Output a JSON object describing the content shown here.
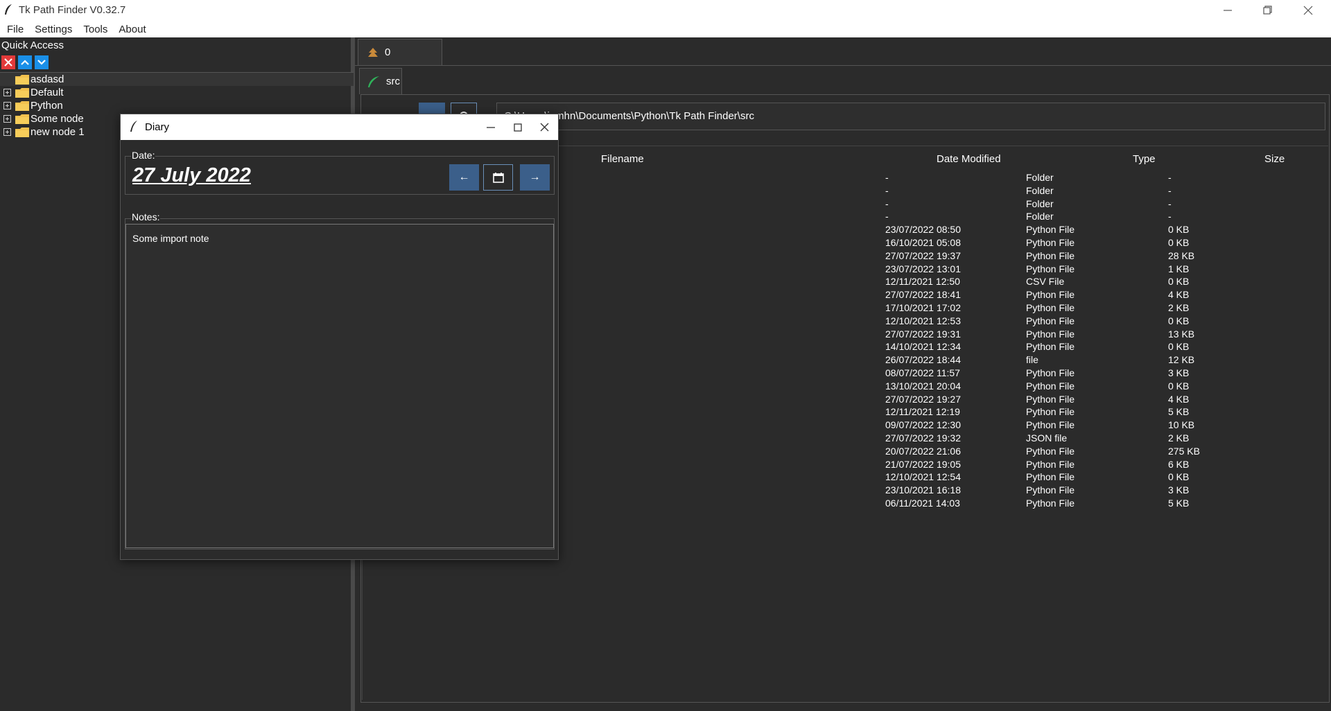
{
  "app": {
    "title": "Tk Path Finder V0.32.7"
  },
  "menu": [
    "File",
    "Settings",
    "Tools",
    "About"
  ],
  "quick_access": {
    "title": "Quick Access",
    "tree": [
      {
        "label": "asdasd",
        "expandable": false
      },
      {
        "label": "Default",
        "expandable": true
      },
      {
        "label": "Python",
        "expandable": true
      },
      {
        "label": "Some node",
        "expandable": true
      },
      {
        "label": "new node 1",
        "expandable": true
      }
    ]
  },
  "tabs": {
    "outer": {
      "label": "0",
      "icon": "tree-icon"
    },
    "inner": {
      "label": "src",
      "icon": "leaf-icon"
    }
  },
  "path": {
    "value": "C:\\Users\\jamhn\\Documents\\Python\\Tk Path Finder\\src"
  },
  "table": {
    "headers": [
      "Filename",
      "Date Modified",
      "Type",
      "Size"
    ],
    "rows": [
      {
        "date": "-",
        "type": "Folder",
        "size": "-"
      },
      {
        "date": "-",
        "type": "Folder",
        "size": "-"
      },
      {
        "date": "-",
        "type": "Folder",
        "size": "-"
      },
      {
        "date": "-",
        "type": "Folder",
        "size": "-"
      },
      {
        "date": "23/07/2022  08:50",
        "type": "Python File",
        "size": "0 KB"
      },
      {
        "date": "16/10/2021  05:08",
        "type": "Python File",
        "size": "0 KB"
      },
      {
        "date": "27/07/2022  19:37",
        "type": "Python File",
        "size": "28 KB"
      },
      {
        "date": "23/07/2022  13:01",
        "type": "Python File",
        "size": "1 KB"
      },
      {
        "date": "12/11/2021  12:50",
        "type": "CSV File",
        "size": "0 KB"
      },
      {
        "date": "27/07/2022  18:41",
        "type": "Python File",
        "size": "4 KB"
      },
      {
        "date": "17/10/2021  17:02",
        "type": "Python File",
        "size": "2 KB"
      },
      {
        "date": "12/10/2021  12:53",
        "type": "Python File",
        "size": "0 KB"
      },
      {
        "date": "27/07/2022  19:31",
        "type": "Python File",
        "size": "13 KB"
      },
      {
        "date": "14/10/2021  12:34",
        "type": "Python File",
        "size": "0 KB"
      },
      {
        "date": "26/07/2022  18:44",
        "type": "file",
        "size": "12 KB"
      },
      {
        "date": "08/07/2022  11:57",
        "type": "Python File",
        "size": "3 KB"
      },
      {
        "date": "13/10/2021  20:04",
        "type": "Python File",
        "size": "0 KB"
      },
      {
        "date": "27/07/2022  19:27",
        "type": "Python File",
        "size": "4 KB"
      },
      {
        "date": "12/11/2021  12:19",
        "type": "Python File",
        "size": "5 KB"
      },
      {
        "date": "09/07/2022  12:30",
        "type": "Python File",
        "size": "10 KB"
      },
      {
        "date": "27/07/2022  19:32",
        "type": "JSON file",
        "size": "2 KB"
      },
      {
        "date": "20/07/2022  21:06",
        "type": "Python File",
        "size": "275 KB"
      },
      {
        "date": "21/07/2022  19:05",
        "type": "Python File",
        "size": "6 KB"
      },
      {
        "date": "12/10/2021  12:54",
        "type": "Python File",
        "size": "0 KB"
      },
      {
        "date": "23/10/2021  16:18",
        "type": "Python File",
        "size": "3 KB"
      },
      {
        "date": "06/11/2021  14:03",
        "type": "Python File",
        "size": "5 KB"
      }
    ]
  },
  "diary": {
    "title": "Diary",
    "date_label": "Date:",
    "date_value": "27 July 2022",
    "prev_label": "←",
    "next_label": "→",
    "notes_label": "Notes:",
    "notes_value": "Some import note"
  },
  "colors": {
    "background": "#2b2b2b",
    "accent_blue": "#3b5f8a",
    "delete_red": "#e33a3a",
    "move_blue": "#1a8fe8",
    "folder_yellow": "#f2c14e"
  }
}
